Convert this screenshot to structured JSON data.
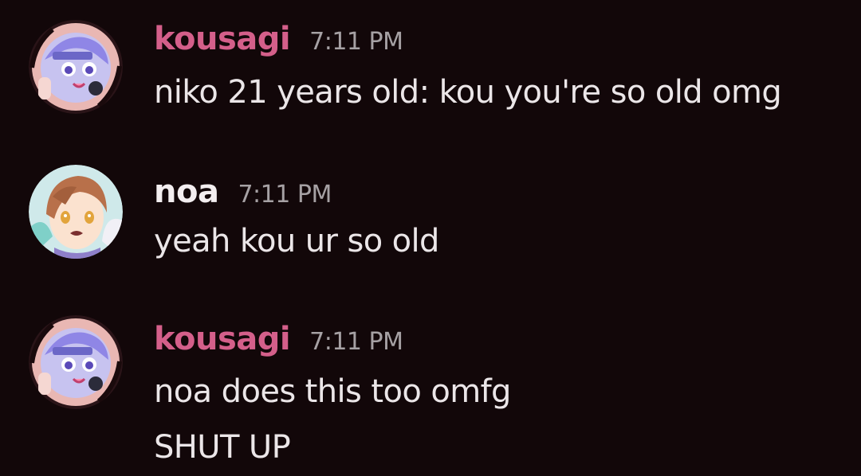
{
  "colors": {
    "background": "#120709",
    "kousagi_name": "#d45f8a",
    "noa_name": "#f3eef0",
    "timestamp": "#a6a1a4",
    "message_text": "#ebe6e8"
  },
  "messages": [
    {
      "username": "kousagi",
      "timestamp": "7:11 PM",
      "avatar_icon": "anime-avatar-icon",
      "lines": [
        "niko 21 years old: kou you're so old omg"
      ]
    },
    {
      "username": "noa",
      "timestamp": "7:11 PM",
      "avatar_icon": "anime-avatar-icon",
      "lines": [
        "yeah kou ur so old"
      ]
    },
    {
      "username": "kousagi",
      "timestamp": "7:11 PM",
      "avatar_icon": "anime-avatar-icon",
      "lines": [
        "noa does this too omfg",
        "SHUT UP"
      ]
    }
  ]
}
